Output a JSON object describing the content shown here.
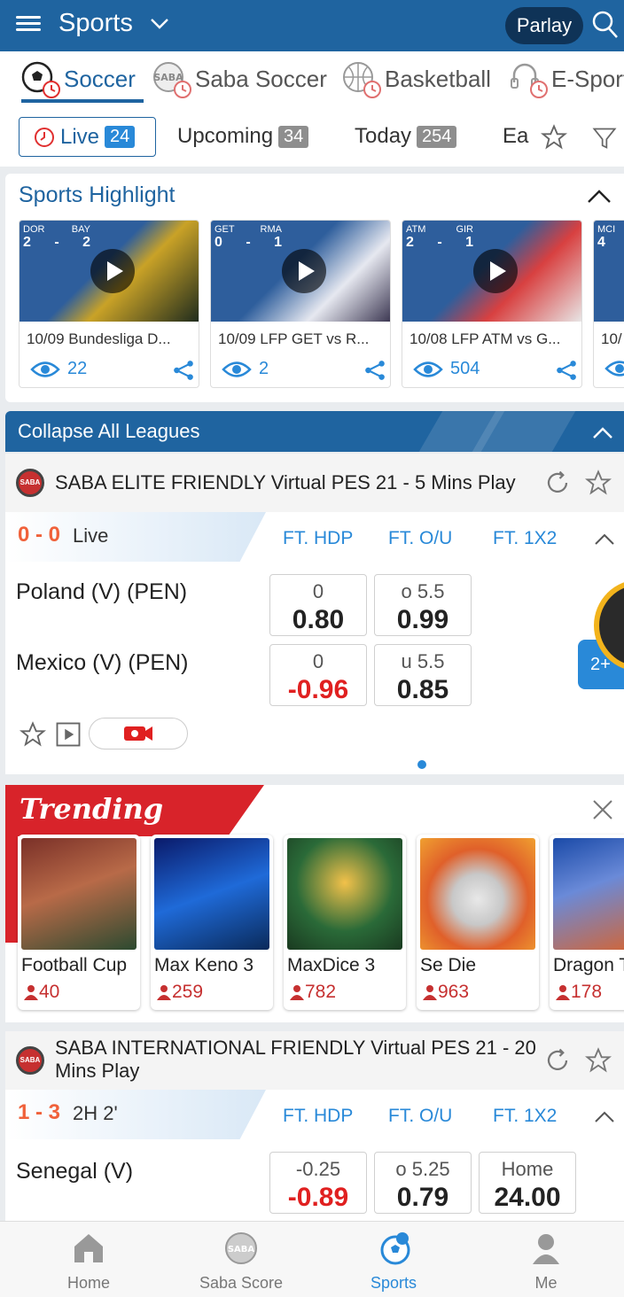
{
  "header": {
    "title": "Sports",
    "parlay_label": "Parlay"
  },
  "sport_tabs": [
    {
      "label": "Soccer",
      "icon": "soccer-ball-icon",
      "active": true
    },
    {
      "label": "Saba Soccer",
      "icon": "saba-soccer-icon",
      "active": false
    },
    {
      "label": "Basketball",
      "icon": "basketball-icon",
      "active": false
    },
    {
      "label": "E-Sport",
      "icon": "esport-headset-icon",
      "active": false
    }
  ],
  "filters": {
    "live": {
      "label": "Live",
      "count": "24"
    },
    "upcoming": {
      "label": "Upcoming",
      "count": "34"
    },
    "today": {
      "label": "Today",
      "count": "254"
    },
    "early": {
      "label": "Ea"
    }
  },
  "highlight": {
    "title": "Sports Highlight",
    "cards": [
      {
        "home": "DOR",
        "away": "BAY",
        "home_score": "2",
        "away_score": "2",
        "title": "10/09 Bundesliga D...",
        "views": "22"
      },
      {
        "home": "GET",
        "away": "RMA",
        "home_score": "0",
        "away_score": "1",
        "title": "10/09 LFP GET vs R...",
        "views": "2"
      },
      {
        "home": "ATM",
        "away": "GIR",
        "home_score": "2",
        "away_score": "1",
        "title": "10/08 LFP ATM vs G...",
        "views": "504"
      },
      {
        "home": "MCI",
        "away": "",
        "home_score": "4",
        "away_score": "",
        "title": "10/",
        "views": ""
      }
    ]
  },
  "collapse_label": "Collapse All Leagues",
  "league1": {
    "name": "SABA ELITE FRIENDLY Virtual PES 21 - 5 Mins Play",
    "score": "0 - 0",
    "status": "Live",
    "cols": [
      "FT. HDP",
      "FT. O/U",
      "FT. 1X2"
    ],
    "home_team": "Poland (V) (PEN)",
    "away_team": "Mexico (V) (PEN)",
    "odds": {
      "home_hdp_line": "0",
      "home_hdp": "0.80",
      "home_ou_line": "o 5.5",
      "home_ou": "0.99",
      "away_hdp_line": "0",
      "away_hdp": "-0.96",
      "away_ou_line": "u 5.5",
      "away_ou": "0.85"
    },
    "more_badge": "2+"
  },
  "trending": {
    "title": "Trending",
    "games": [
      {
        "name": "Football Cup",
        "players": "40"
      },
      {
        "name": "Max Keno 3",
        "players": "259"
      },
      {
        "name": "MaxDice 3",
        "players": "782"
      },
      {
        "name": "Se Die",
        "players": "963"
      },
      {
        "name": "Dragon T",
        "players": "178"
      }
    ]
  },
  "league2": {
    "name_line1": "SABA INTERNATIONAL FRIENDLY Virtual PES 21 - 20",
    "name_line2": "Mins Play",
    "score": "1 - 3",
    "status": "2H 2'",
    "cols": [
      "FT. HDP",
      "FT. O/U",
      "FT. 1X2"
    ],
    "home_team": "Senegal (V)",
    "odds": {
      "hdp_line": "-0.25",
      "hdp": "-0.89",
      "ou_line": "o 5.25",
      "ou": "0.79",
      "x_line": "Home",
      "x": "24.00"
    }
  },
  "bottom_nav": [
    {
      "label": "Home",
      "icon": "home-icon"
    },
    {
      "label": "Saba Score",
      "icon": "saba-score-icon"
    },
    {
      "label": "Sports",
      "icon": "sports-ball-icon",
      "active": true
    },
    {
      "label": "Me",
      "icon": "user-icon"
    }
  ],
  "colors": {
    "primary": "#1f64a0",
    "accent": "#2989d8",
    "score_orange": "#f0613a",
    "negative_red": "#e02020"
  }
}
